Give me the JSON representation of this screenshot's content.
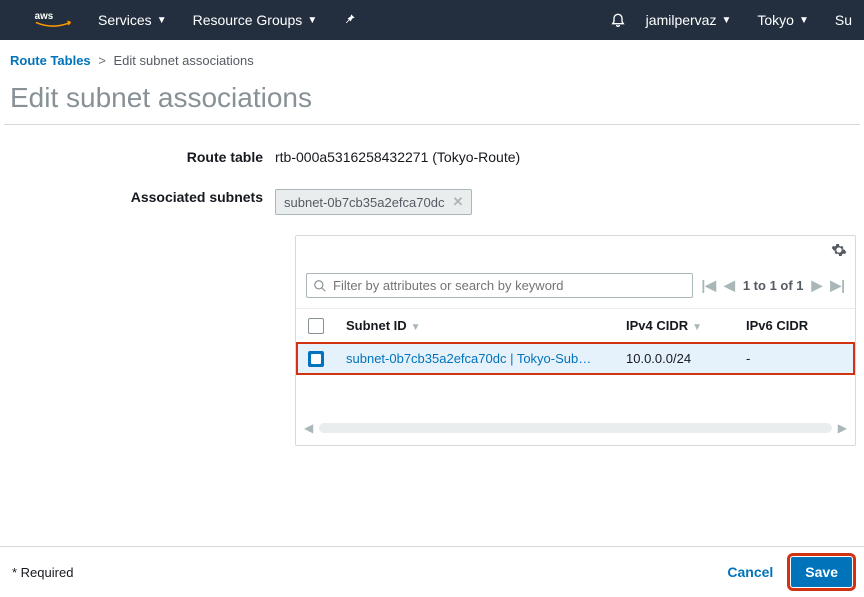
{
  "nav": {
    "services": "Services",
    "resource_groups": "Resource Groups",
    "username": "jamilpervaz",
    "region": "Tokyo",
    "support": "Su"
  },
  "breadcrumb": {
    "root": "Route Tables",
    "current": "Edit subnet associations"
  },
  "page_title": "Edit subnet associations",
  "form": {
    "route_table_label": "Route table",
    "route_table_value": "rtb-000a5316258432271 (Tokyo-Route)",
    "assoc_label": "Associated subnets",
    "assoc_tag": "subnet-0b7cb35a2efca70dc"
  },
  "table": {
    "search_placeholder": "Filter by attributes or search by keyword",
    "pager": "1 to 1 of 1",
    "headers": {
      "subnet_id": "Subnet ID",
      "ipv4": "IPv4 CIDR",
      "ipv6": "IPv6 CIDR"
    },
    "rows": [
      {
        "subnet_display": "subnet-0b7cb35a2efca70dc | Tokyo-Sub…",
        "ipv4": "10.0.0.0/24",
        "ipv6": "-"
      }
    ]
  },
  "footer": {
    "required": "* Required",
    "cancel": "Cancel",
    "save": "Save"
  }
}
